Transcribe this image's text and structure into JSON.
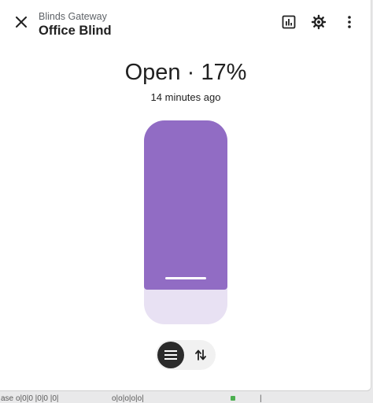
{
  "dialog": {
    "subtitle": "Blinds Gateway",
    "title": "Office Blind"
  },
  "icons": {
    "close": "close-icon",
    "history": "chart-box-icon",
    "settings": "gear-icon",
    "more": "dots-vertical-icon",
    "position_mode": "menu-icon",
    "buttons_mode": "swap-vertical-icon"
  },
  "state": {
    "text": "Open · 17%",
    "position_percent": 17,
    "last_changed": "14 minutes ago"
  },
  "colors": {
    "slider_fill": "#916cc4",
    "slider_track": "#e8e1f3",
    "active_mode_bg": "#2b2b2b"
  },
  "mode_toggle": {
    "selected": "position"
  },
  "background": {
    "fragments": [
      "ase",
      "o|0|0 |0|0 |0|",
      "o|o|o|o|o|",
      "|"
    ]
  }
}
